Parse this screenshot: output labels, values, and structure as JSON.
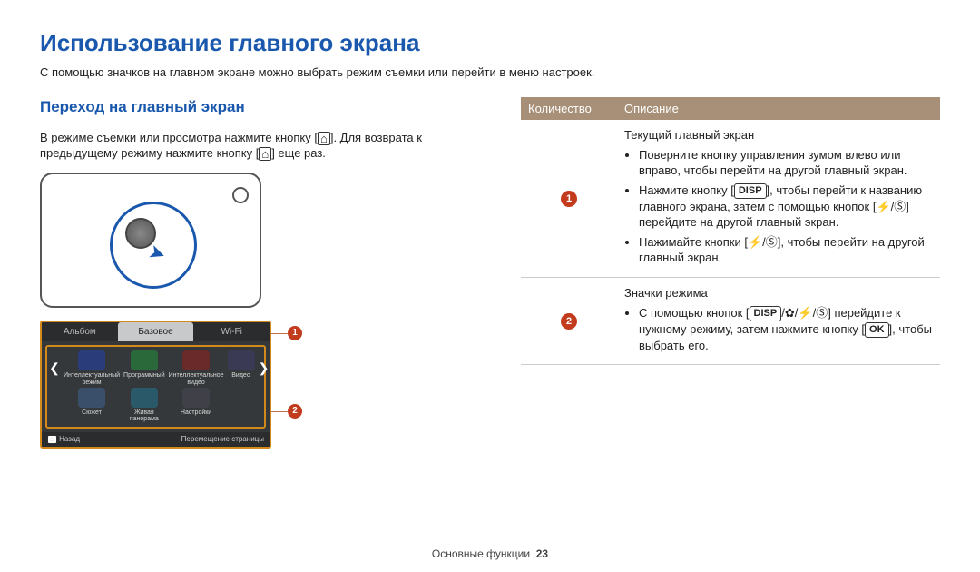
{
  "title": "Использование главного экрана",
  "intro": "С помощью значков на главном экране можно выбрать режим съемки или перейти в меню настроек.",
  "left": {
    "subtitle": "Переход на главный экран",
    "para_a": "В режиме съемки или просмотра нажмите кнопку [",
    "para_b": "]. Для возврата к предыдущему режиму нажмите кнопку [",
    "para_c": "] еще раз."
  },
  "shot": {
    "tabs": [
      "Альбом",
      "Базовое",
      "Wi-Fi"
    ],
    "apps_row1": [
      {
        "label": "Интеллектуальный\nрежим",
        "bg": "#2a3d7a"
      },
      {
        "label": "Программный",
        "bg": "#2a6a3a"
      },
      {
        "label": "Интеллектуальное\nвидео",
        "bg": "#6a2a2a"
      },
      {
        "label": "Видео",
        "bg": "#3a3a55"
      }
    ],
    "apps_row2": [
      {
        "label": "Сюжет",
        "bg": "#3a506a"
      },
      {
        "label": "Живая\nпанорама",
        "bg": "#2a5a6a"
      },
      {
        "label": "Настройки",
        "bg": "#404048"
      }
    ],
    "bottom_left": "Назад",
    "bottom_right": "Перемещение страницы"
  },
  "callouts": {
    "c1": "1",
    "c2": "2"
  },
  "table": {
    "head": [
      "Количество",
      "Описание"
    ],
    "row1": {
      "title": "Текущий главный экран",
      "b1": "Поверните кнопку управления зумом влево или вправо, чтобы перейти на другой главный экран.",
      "b2a": "Нажмите кнопку [",
      "b2btn": "DISP",
      "b2b": "], чтобы перейти к названию главного экрана, затем с помощью кнопок [",
      "b2c": "] перейдите на другой главный экран.",
      "b3a": "Нажимайте кнопки [",
      "b3b": "], чтобы перейти на другой главный экран."
    },
    "row2": {
      "title": "Значки режима",
      "b1a": "С помощью кнопок [",
      "b1disp": "DISP",
      "b1b": "] перейдите к нужному режиму, затем нажмите кнопку [",
      "b1ok": "OK",
      "b1c": "], чтобы выбрать его."
    }
  },
  "footer_label": "Основные функции",
  "footer_page": "23"
}
